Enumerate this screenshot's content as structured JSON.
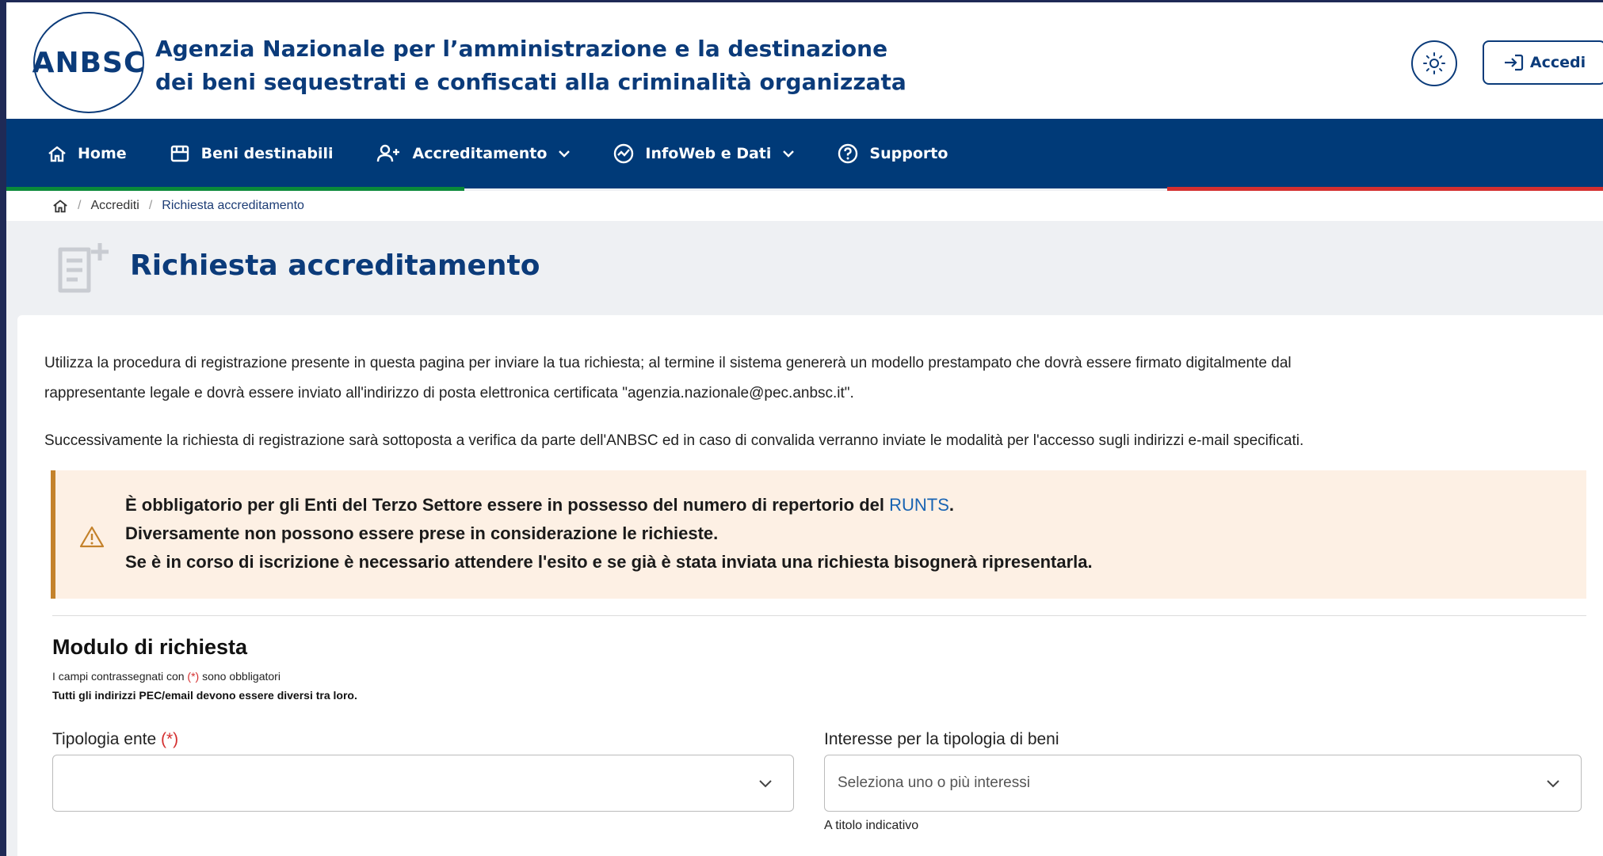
{
  "header": {
    "logo_text": "ANBSC",
    "agency_line1": "Agenzia Nazionale per l’amministrazione e la destinazione",
    "agency_line2": "dei beni sequestrati e confiscati alla criminalità organizzata",
    "login_label": "Accedi",
    "theme_icon": "sun-icon"
  },
  "nav": {
    "items": [
      {
        "label": "Home",
        "icon": "home-icon"
      },
      {
        "label": "Beni destinabili",
        "icon": "shop-icon"
      },
      {
        "label": "Accreditamento",
        "icon": "add-user-icon"
      },
      {
        "label": "InfoWeb e Dati",
        "icon": "chart-icon"
      },
      {
        "label": "Supporto",
        "icon": "help-icon"
      }
    ]
  },
  "breadcrumb": {
    "items": [
      "Accrediti",
      "Richiesta accreditamento"
    ],
    "separator": "/"
  },
  "page": {
    "title": "Richiesta accreditamento"
  },
  "intro": {
    "paragraph1_line1": "Utilizza la procedura di registrazione presente in questa pagina per inviare la tua richiesta; al termine il sistema genererà un modello prestampato che dovrà essere firmato digitalmente dal",
    "paragraph1_line2": "rappresentante legale e dovrà essere inviato all'indirizzo di posta elettronica certificata \"agenzia.nazionale@pec.anbsc.it\".",
    "paragraph2": "Successivamente la richiesta di registrazione sarà sottoposta a verifica da parte dell'ANBSC ed in caso di convalida verranno inviate le modalità per l'accesso sugli indirizzi e-mail specificati."
  },
  "warning": {
    "line1_prefix": "È obbligatorio per gli Enti del Terzo Settore essere in possesso del numero di repertorio del ",
    "line1_link": "RUNTS",
    "line1_suffix": ".",
    "line2": "Diversamente non possono essere prese in considerazione le richieste.",
    "line3": "Se è in corso di iscrizione è necessario attendere l'esito e se già è stata inviata una richiesta bisognerà ripresentarla."
  },
  "form": {
    "title": "Modulo di richiesta",
    "required_prefix": "I campi contrassegnati con ",
    "required_marker": "(*)",
    "required_suffix": " sono obbligatori",
    "pec_note": "Tutti gli indirizzi PEC/email devono essere diversi tra loro.",
    "field1_label": "Tipologia ente ",
    "field1_required": "(*)",
    "field1_value": "",
    "field2_label": "Interesse per la tipologia di beni",
    "field2_placeholder": "Seleziona uno o più interessi",
    "field2_hint": "A titolo indicativo"
  },
  "colors": {
    "primary": "#003a78",
    "brand_text": "#0b3b7a",
    "warning_bg": "#fdf0e4",
    "warning_border": "#c4822b",
    "required": "#d42f2f",
    "link": "#1964b3"
  }
}
